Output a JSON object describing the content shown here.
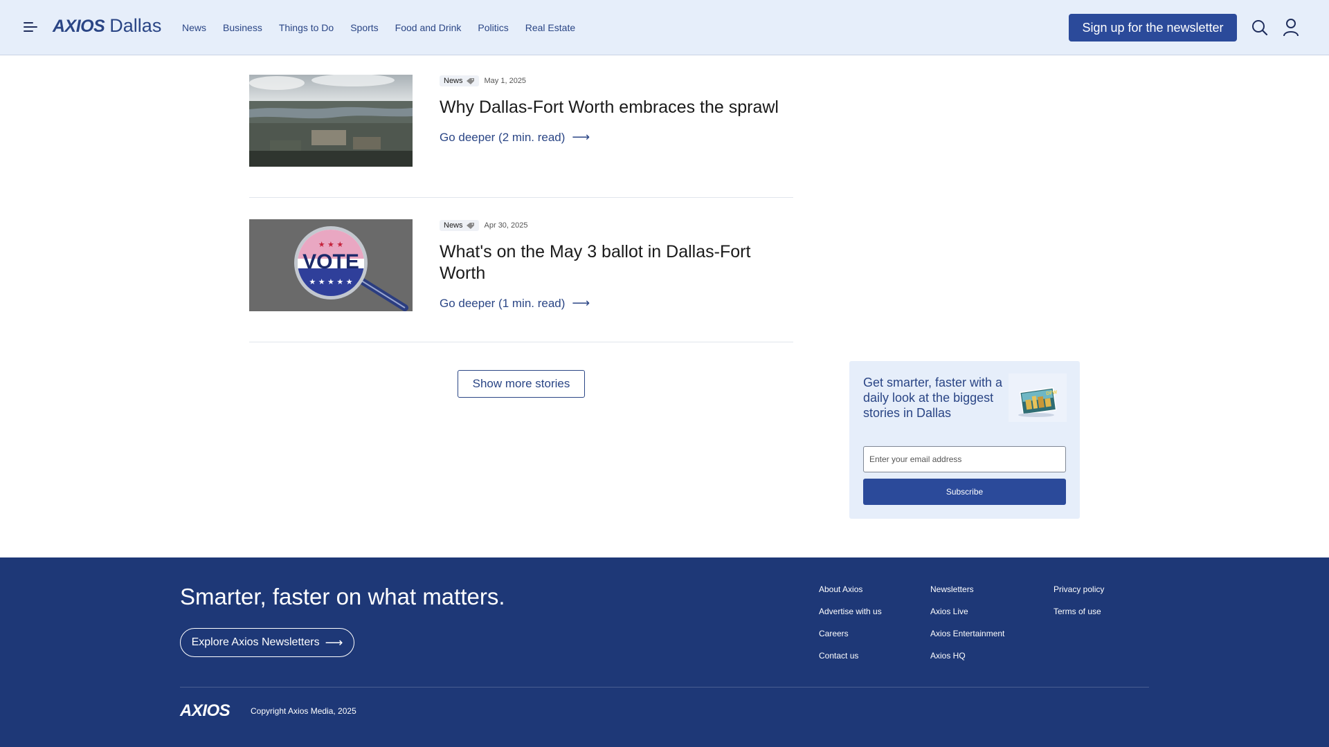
{
  "header": {
    "logo_brand": "AXIOS",
    "logo_city": "Dallas",
    "nav": [
      "News",
      "Business",
      "Things to Do",
      "Sports",
      "Food and Drink",
      "Politics",
      "Real Estate"
    ],
    "signup_label": "Sign up for the newsletter"
  },
  "stories": [
    {
      "tag": "News",
      "date": "May 1, 2025",
      "title": "Why Dallas-Fort Worth embraces the sprawl",
      "link": "Go deeper (2 min. read)",
      "image": "aerial-suburbs-lake"
    },
    {
      "tag": "News",
      "date": "Apr 30, 2025",
      "title": "What's on the May 3 ballot in Dallas-Fort Worth",
      "link": "Go deeper (1 min. read)",
      "image": "vote-button-magnifier"
    }
  ],
  "show_more_label": "Show more stories",
  "newsletter": {
    "text": "Get smarter, faster with a daily look at the biggest stories in Dallas",
    "email_placeholder": "Enter your email address",
    "subscribe_label": "Subscribe"
  },
  "footer": {
    "tagline": "Smarter, faster on what matters.",
    "explore_label": "Explore Axios Newsletters",
    "columns": [
      [
        "About Axios",
        "Advertise with us",
        "Careers",
        "Contact us"
      ],
      [
        "Newsletters",
        "Axios Live",
        "Axios Entertainment",
        "Axios HQ"
      ],
      [
        "Privacy policy",
        "Terms of use"
      ]
    ],
    "logo": "AXIOS",
    "copyright": "Copyright Axios Media, 2025"
  },
  "colors": {
    "brand_blue": "#2a4585",
    "button_blue": "#2b4a9a",
    "footer_blue": "#1e3877",
    "header_bg": "#e6eefa"
  }
}
